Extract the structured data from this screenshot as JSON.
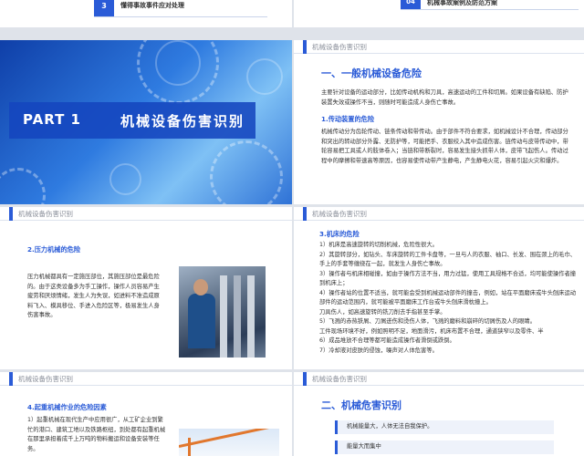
{
  "top_strip": {
    "left_num": "3",
    "left_text": "懂得事故事件应对处理",
    "right_num": "04",
    "right_text": "机械事故案例及防范方案"
  },
  "slide_part": {
    "part_label": "PART 1",
    "title": "机械设备伤害识别"
  },
  "slide_a": {
    "header": "机械设备伤害识别",
    "heading": "一、一般机械设备危险",
    "intro": "主要针对设备的运动部分，比如传动机构和刀具，高速运动的工件和切屑。如果设备有缺陷、防护装置失效或操作不当，则随时可能造成人身伤亡事故。",
    "sub": "1.传动装置的危险",
    "para": "机械传动分为齿轮传动、链条传动和带传动。由于部件不符合要求，如机械设计不合理，传动部分和突出的转动部分外露、无防护等，可能把手、衣服绞入其中造成伤害。链传动与皮带传动中，带轮容易把工具或人的肢体卷入；当链和带断裂时，容易发生接头抓带人体，皮带飞起伤人。传动过程中的摩擦和带速高等原因，也容易使传动带产生静电，产生静电火花，容易引起火灾和爆炸。"
  },
  "slide_b": {
    "header": "机械设备伤害识别",
    "sub": "2.压力机械的危险",
    "para": "压力机械都具有一定施压部位，其施压部位是最危险的。由于这类设备多为手工操作，操作人员容易产生疲劳和厌烦情绪，发生人为失误，如进料不准造成原料飞入、模具移位、手进入危险区等，极易发生人身伤害事故。"
  },
  "slide_c": {
    "header": "机械设备伤害识别",
    "sub": "3.机床的危险",
    "items": [
      "1）机床是高速旋转的切削机械，危险性很大。",
      "2）其旋转部分，如钻头、车床旋转的工件卡盘等，一旦与人的衣服、袖口、长发、围在颈上的毛巾、手上的手套等缠绕在一起，就发生人身伤亡事故。",
      "3）操作者与机床相碰撞，如由于操作方法不当，用力过猛，使用工具规格不合适，均可能使操作者撞到机床上；",
      "4）操作者站的位置不适当，就可能会受到机械运动部件的撞击，例如，站在平面磨床或牛头刨床运动部件的运动范围内，就可能被平面磨床工作台或牛头刨床滑枕撞上。",
      "刀具伤人，如高速旋转的铣刀削去手指甚至手掌。",
      "5）飞溅的赤热铁屑、刀屑迸伤和烫伤人体，飞溅的磨料和崩碎的切屑伤及人的眼睛。",
      "工件现场环境不好，例如照明不足，地面滑污，机床布置不合理，通道狭窄以及零件、半",
      "6）成品堆放不合理等都可能造成操作者滑倒或跌倒。",
      "7）冷却液对皮肤的侵蚀，噪声对人体危害等。"
    ]
  },
  "slide_d": {
    "header": "机械设备伤害识别",
    "sub": "4.起重机械作业的危险因素",
    "para": "1）起重机械在现代生产中应用很广，从工矿企业到繁忙的港口、建筑工地以及铁路枢纽，到处都有起重机械在那里承担着成千上万吨的物料搬运和设备安装等任务。"
  },
  "slide_e": {
    "header": "机械设备伤害识别",
    "heading": "二、机械危害识别",
    "box1": "机械能量大，人体无法自我保护。",
    "box2": "能量大而集中"
  }
}
